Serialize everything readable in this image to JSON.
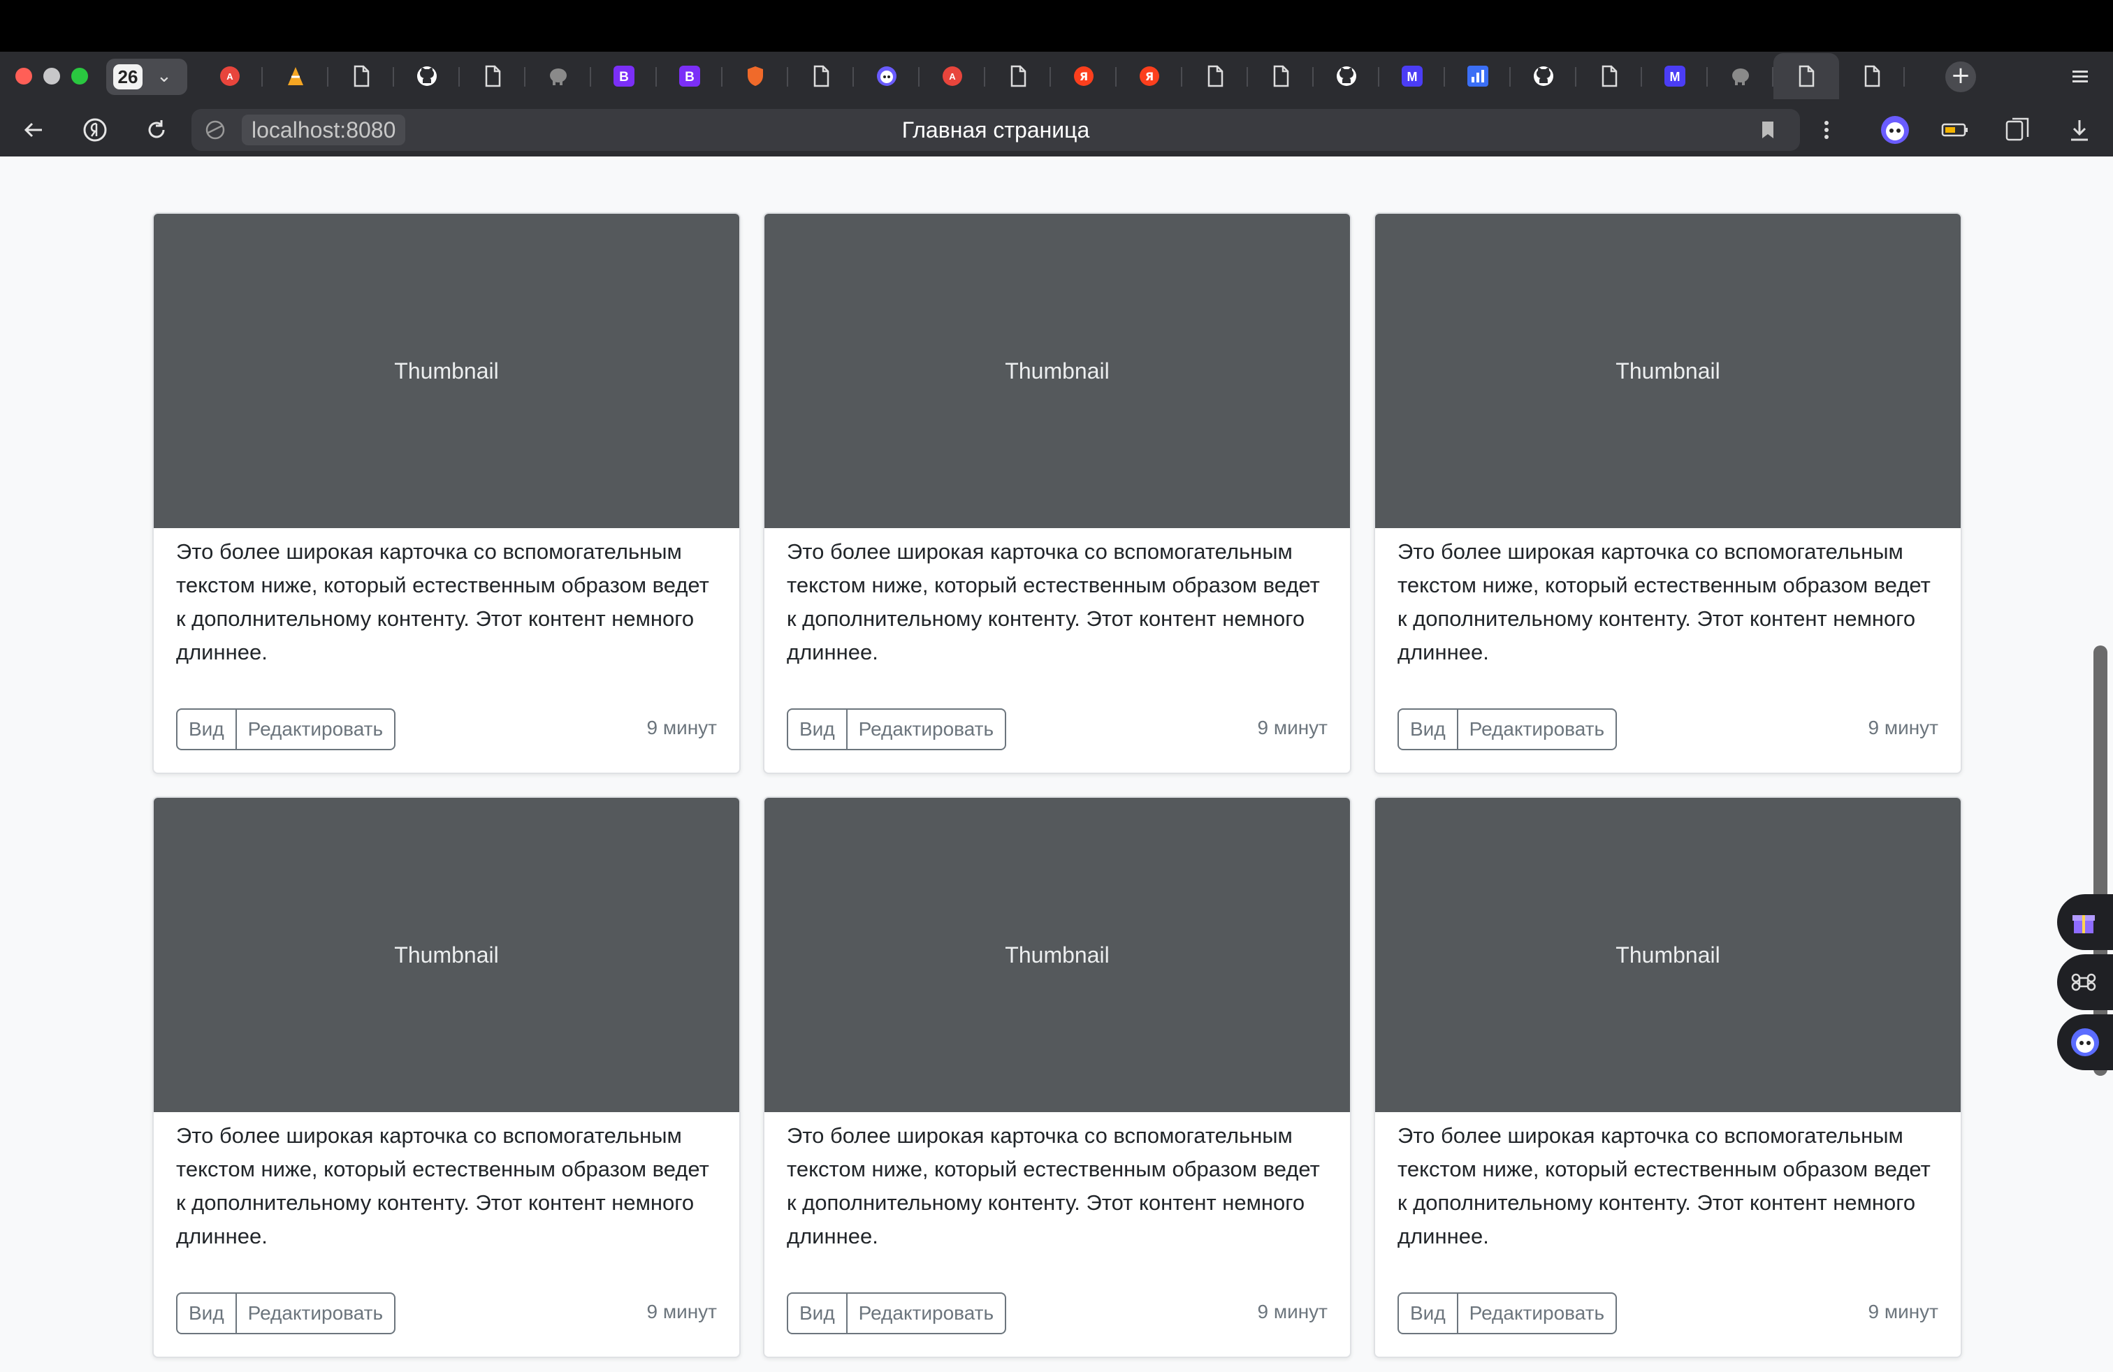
{
  "browser": {
    "tab_count": "26",
    "address": "localhost:8080",
    "page_title": "Главная страница",
    "tabs": [
      {
        "icon": "translate-icon"
      },
      {
        "icon": "cone-icon"
      },
      {
        "icon": "document-icon"
      },
      {
        "icon": "github-icon"
      },
      {
        "icon": "document-icon"
      },
      {
        "icon": "elephant-icon"
      },
      {
        "icon": "bootstrap-icon"
      },
      {
        "icon": "bootstrap-icon"
      },
      {
        "icon": "shield-icon"
      },
      {
        "icon": "document-icon"
      },
      {
        "icon": "alice-icon"
      },
      {
        "icon": "translate-icon"
      },
      {
        "icon": "document-icon"
      },
      {
        "icon": "yandex-icon"
      },
      {
        "icon": "yandex-icon"
      },
      {
        "icon": "document-icon"
      },
      {
        "icon": "document-icon"
      },
      {
        "icon": "github-icon"
      },
      {
        "icon": "m-icon"
      },
      {
        "icon": "chart-icon"
      },
      {
        "icon": "github-icon"
      },
      {
        "icon": "document-icon"
      },
      {
        "icon": "m-icon"
      },
      {
        "icon": "elephant-icon"
      },
      {
        "icon": "document-icon",
        "active": true
      },
      {
        "icon": "document-icon"
      }
    ]
  },
  "colors": {
    "thumbnail_bg": "#55595c",
    "page_bg": "#f8f9fa",
    "muted": "#6c757d"
  },
  "cards": [
    {
      "thumbnail": "Thumbnail",
      "text": "Это более широкая карточка со вспомогательным текстом ниже, который естественным образом ведет к дополнительному контенту. Этот контент немного длиннее.",
      "view_label": "Вид",
      "edit_label": "Редактировать",
      "time": "9 минут"
    },
    {
      "thumbnail": "Thumbnail",
      "text": "Это более широкая карточка со вспомогательным текстом ниже, который естественным образом ведет к дополнительному контенту. Этот контент немного длиннее.",
      "view_label": "Вид",
      "edit_label": "Редактировать",
      "time": "9 минут"
    },
    {
      "thumbnail": "Thumbnail",
      "text": "Это более широкая карточка со вспомогательным текстом ниже, который естественным образом ведет к дополнительному контенту. Этот контент немного длиннее.",
      "view_label": "Вид",
      "edit_label": "Редактировать",
      "time": "9 минут"
    },
    {
      "thumbnail": "Thumbnail",
      "text": "Это более широкая карточка со вспомогательным текстом ниже, который естественным образом ведет к дополнительному контенту. Этот контент немного длиннее.",
      "view_label": "Вид",
      "edit_label": "Редактировать",
      "time": "9 минут"
    },
    {
      "thumbnail": "Thumbnail",
      "text": "Это более широкая карточка со вспомогательным текстом ниже, который естественным образом ведет к дополнительному контенту. Этот контент немного длиннее.",
      "view_label": "Вид",
      "edit_label": "Редактировать",
      "time": "9 минут"
    },
    {
      "thumbnail": "Thumbnail",
      "text": "Это более широкая карточка со вспомогательным текстом ниже, который естественным образом ведет к дополнительному контенту. Этот контент немного длиннее.",
      "view_label": "Вид",
      "edit_label": "Редактировать",
      "time": "9 минут"
    }
  ]
}
